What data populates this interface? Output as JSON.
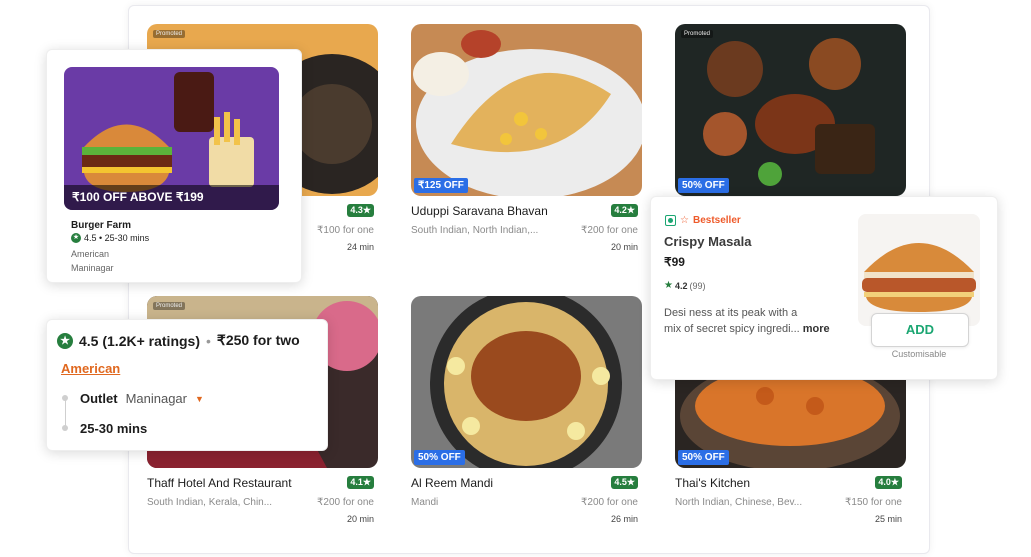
{
  "cards": [
    {
      "name": "",
      "promoted": "Promoted",
      "rating": "4.3★",
      "cuisine": "",
      "price": "₹100 for one",
      "time": "24 min"
    },
    {
      "name": "Uduppi Saravana Bhavan",
      "offer": "₹125 OFF",
      "rating": "4.2★",
      "cuisine": "South Indian, North Indian,...",
      "price": "₹200 for one",
      "time": "20 min"
    },
    {
      "name": "",
      "promoted": "Promoted",
      "offer": "50% OFF"
    },
    {
      "name": "Thaff Hotel And Restaurant",
      "promoted": "Promoted",
      "rating": "4.1★",
      "cuisine": "South Indian, Kerala, Chin...",
      "price": "₹200 for one",
      "time": "20 min"
    },
    {
      "name": "Al Reem Mandi",
      "offer": "50% OFF",
      "rating": "4.5★",
      "cuisine": "Mandi",
      "price": "₹200 for one",
      "time": "26 min"
    },
    {
      "name": "Thai's Kitchen",
      "offer": "50% OFF",
      "rating": "4.0★",
      "cuisine": "North Indian, Chinese, Bev...",
      "price": "₹150 for one",
      "time": "25 min"
    }
  ],
  "burger_card": {
    "offer": "₹100 OFF ABOVE ₹199",
    "name": "Burger Farm",
    "meta": "4.5 • 25-30 mins",
    "cuisine": "American",
    "location": "Maninagar"
  },
  "info_card": {
    "rating": "4.5 (1.2K+ ratings)",
    "dot": "•",
    "price": "₹250 for two",
    "cuisine": "American",
    "outlet_label": "Outlet",
    "outlet_value": "Maninagar",
    "time": "25-30 mins"
  },
  "dish_card": {
    "badge": "Bestseller",
    "name": "Crispy Masala",
    "price": "₹99",
    "rating": "4.2",
    "rating_count": "(99)",
    "desc_line1": "Desi ness at its peak with a",
    "desc_line2": "mix of secret spicy ingredi...",
    "more": "more",
    "add": "ADD",
    "customisable": "Customisable"
  },
  "colors": {
    "rating_green": "#267e3e",
    "offer_blue": "#2b6ee6",
    "accent_orange": "#e0681f",
    "add_green": "#1ba672",
    "bestseller": "#ee5a2a"
  }
}
